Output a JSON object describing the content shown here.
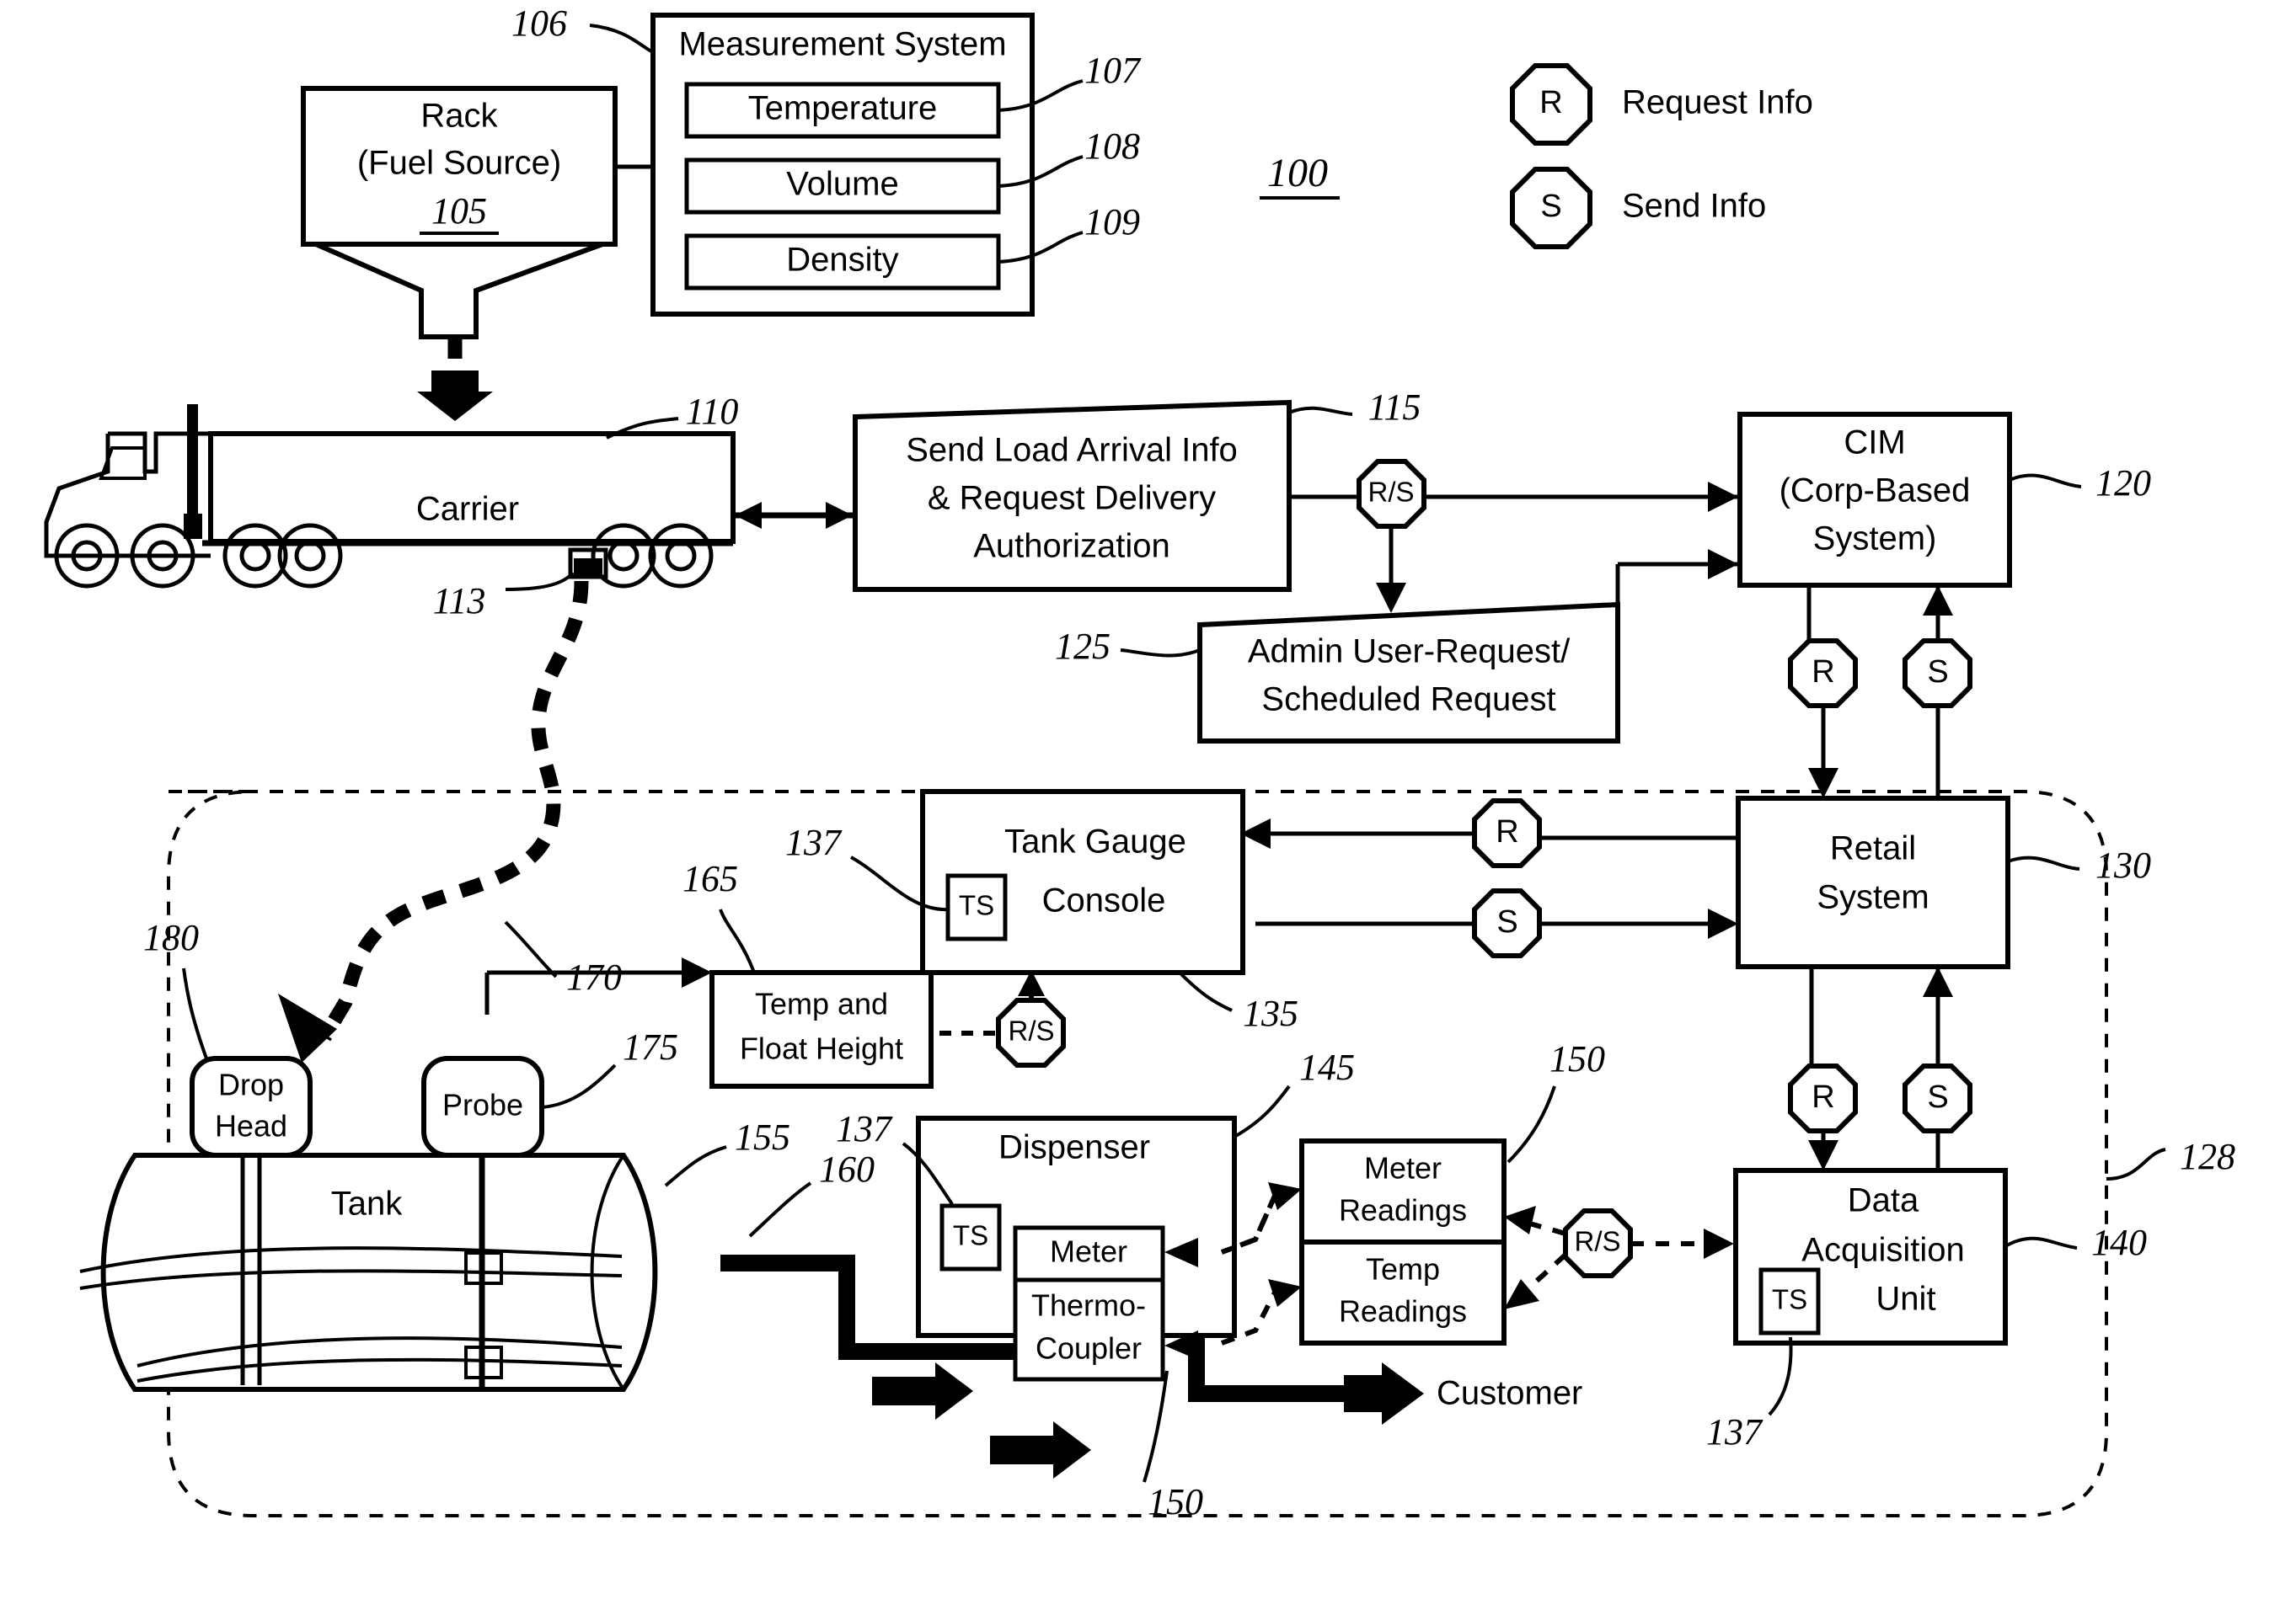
{
  "figure": {
    "ref_main": "100",
    "legend": [
      {
        "symbol": "R",
        "label": "Request Info"
      },
      {
        "symbol": "S",
        "label": "Send Info"
      }
    ]
  },
  "nodes": {
    "rack": {
      "title": "Rack",
      "subtitle": "(Fuel Source)",
      "ref": "105"
    },
    "measurement_system": {
      "title": "Measurement System",
      "ref": "106",
      "items": [
        {
          "label": "Temperature",
          "ref": "107"
        },
        {
          "label": "Volume",
          "ref": "108"
        },
        {
          "label": "Density",
          "ref": "109"
        }
      ]
    },
    "carrier": {
      "label": "Carrier",
      "ref": "110",
      "sensor_ref": "113"
    },
    "send_load": {
      "line1": "Send Load Arrival Info",
      "line2": "& Request Delivery",
      "line3": "Authorization",
      "ref": "115"
    },
    "cim": {
      "line1": "CIM",
      "line2": "(Corp-Based",
      "line3": "System)",
      "ref": "120"
    },
    "admin_request": {
      "line1": "Admin User-Request/",
      "line2": "Scheduled Request",
      "ref": "125"
    },
    "site_boundary": {
      "ref": "128"
    },
    "retail_system": {
      "line1": "Retail",
      "line2": "System",
      "ref": "130"
    },
    "tank_gauge_console": {
      "line1": "Tank Gauge",
      "line2": "Console",
      "ref": "135",
      "ts_label": "TS",
      "ts_ref": "137"
    },
    "data_acquisition_unit": {
      "line1": "Data",
      "line2": "Acquisition",
      "line3": "Unit",
      "ref": "140",
      "ts_label": "TS",
      "ts_ref": "137"
    },
    "dispenser": {
      "label": "Dispenser",
      "ref": "145",
      "ts_label": "TS",
      "ts_ref": "137",
      "meter": "Meter",
      "thermocoupler_line1": "Thermo-",
      "thermocoupler_line2": "Coupler",
      "flow_ref": "150"
    },
    "readings": {
      "meter_line1": "Meter",
      "meter_line2": "Readings",
      "temp_line1": "Temp",
      "temp_line2": "Readings",
      "ref": "150"
    },
    "temp_float": {
      "line1": "Temp and",
      "line2": "Float Height",
      "ref": "165"
    },
    "probe": {
      "label": "Probe",
      "ref": "175"
    },
    "drop_head": {
      "line1": "Drop",
      "line2": "Head",
      "ref": "180"
    },
    "tank": {
      "label": "Tank",
      "ref": "155",
      "pipe_ref": "160"
    },
    "delivery_path": {
      "ref": "170"
    },
    "customer": {
      "label": "Customer"
    }
  },
  "connectors": {
    "rs_cim": "R/S",
    "r_cim_retail": "R",
    "s_retail_cim": "S",
    "r_tank_gauge": "R",
    "s_tank_gauge": "S",
    "rs_temp_float": "R/S",
    "r_dau": "R",
    "s_dau": "S",
    "rs_dau": "R/S"
  }
}
